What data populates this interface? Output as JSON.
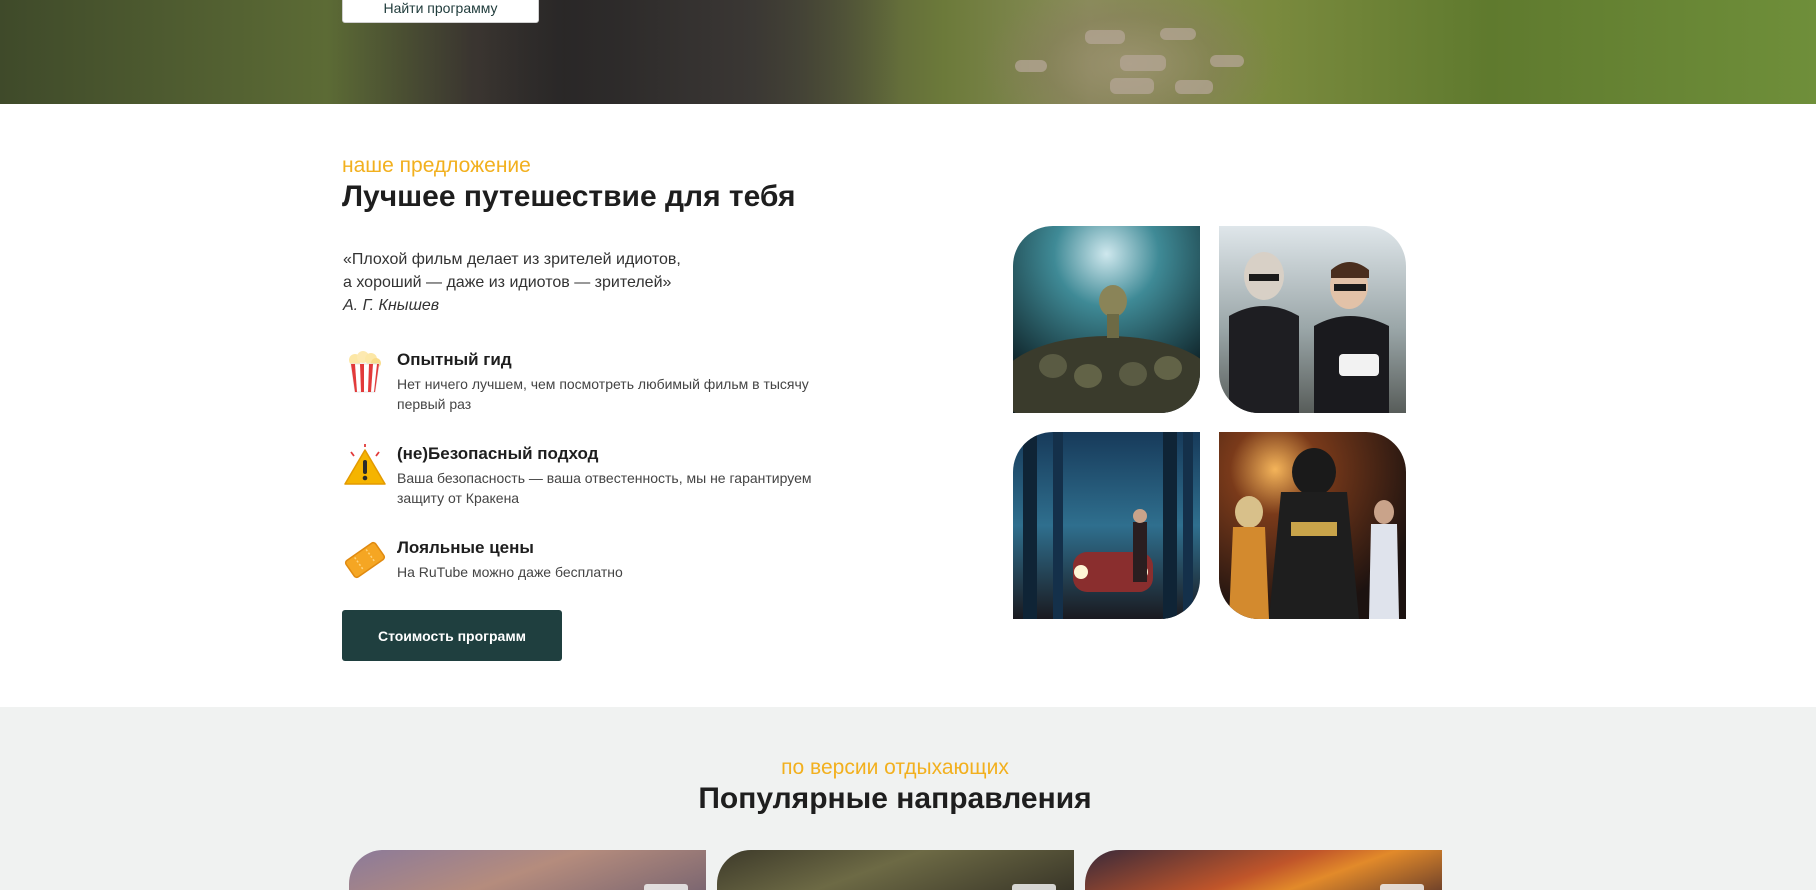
{
  "hero": {
    "button_label": "Найти программу"
  },
  "offer": {
    "eyebrow": "наше предложение",
    "title": "Лучшее путешествие для тебя",
    "quote_line1": "«Плохой фильм делает из зрителей идиотов,",
    "quote_line2": "а хороший — даже из идиотов — зрителей»",
    "quote_author": "А. Г. Кнышев",
    "features": [
      {
        "icon": "popcorn-icon",
        "title": "Опытный гид",
        "text": "Нет ничего лучшем, чем посмотреть любимый фильм в тысячу первый раз"
      },
      {
        "icon": "warning-icon",
        "title": "(не)Безопасный подход",
        "text": "Ваша безопасность — ваша отвестенность, мы не гарантируем защиту от Кракена"
      },
      {
        "icon": "ticket-icon",
        "title": "Лояльные цены",
        "text": "На RuTube можно даже бесплатно"
      }
    ],
    "cta_label": "Стоимость программ",
    "photos": [
      "concert-crowd-photo",
      "motorcycle-pizza-photo",
      "forest-car-photo",
      "vader-dance-photo"
    ]
  },
  "popular": {
    "eyebrow": "по версии отдыхающих",
    "title": "Популярные направления"
  },
  "colors": {
    "accent": "#f2b01e",
    "dark_teal": "#1f3f3f",
    "section_bg": "#f0f2f1"
  }
}
